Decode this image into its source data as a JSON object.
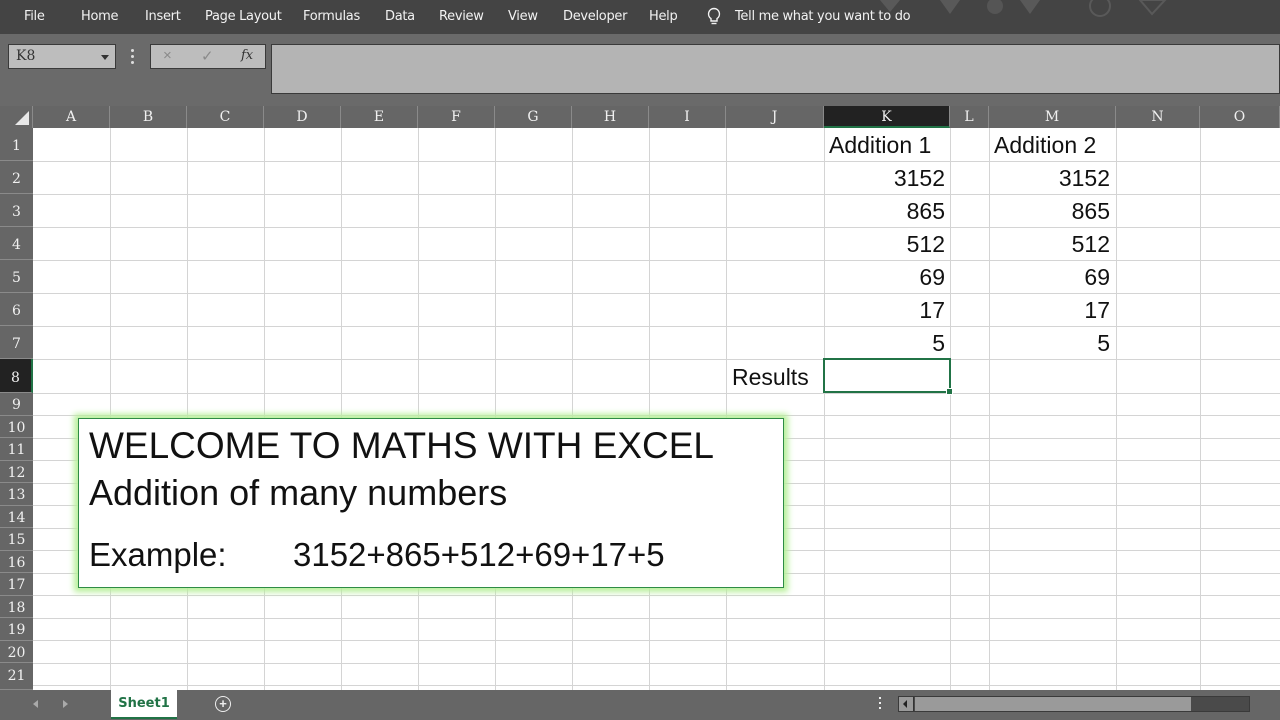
{
  "menu": {
    "items": [
      "File",
      "Home",
      "Insert",
      "Page Layout",
      "Formulas",
      "Data",
      "Review",
      "View",
      "Developer",
      "Help"
    ],
    "tell_me": "Tell me what you want to do"
  },
  "formula_bar": {
    "name_box": "K8",
    "cancel_icon": "×",
    "enter_icon": "✓",
    "fx_label": "fx",
    "formula_value": ""
  },
  "sheet": {
    "columns": [
      "A",
      "B",
      "C",
      "D",
      "E",
      "F",
      "G",
      "H",
      "I",
      "J",
      "K",
      "L",
      "M",
      "N",
      "O"
    ],
    "selected_column": "K",
    "rows": [
      "1",
      "2",
      "3",
      "4",
      "5",
      "6",
      "7",
      "8",
      "9",
      "10",
      "11",
      "12",
      "13",
      "14",
      "15",
      "16",
      "17",
      "18",
      "19",
      "20",
      "21"
    ],
    "selected_row": "8",
    "selected_cell": "K8",
    "cells": {
      "K1": "Addition 1",
      "K2": "3152",
      "K3": "865",
      "K4": "512",
      "K5": "69",
      "K6": "17",
      "K7": "5",
      "M1": "Addition 2",
      "M2": "3152",
      "M3": "865",
      "M4": "512",
      "M5": "69",
      "M6": "17",
      "M7": "5",
      "J8": "Results",
      "K8": ""
    }
  },
  "textbox": {
    "title": "WELCOME TO MATHS WITH EXCEL",
    "subtitle": "Addition of many numbers",
    "example_label": "Example:",
    "example_value": "3152+865+512+69+17+5"
  },
  "bottom": {
    "sheet_tab": "Sheet1",
    "add_sheet": "+"
  },
  "colors": {
    "accent": "#217346",
    "textbox_glow": "#b8f09a"
  }
}
